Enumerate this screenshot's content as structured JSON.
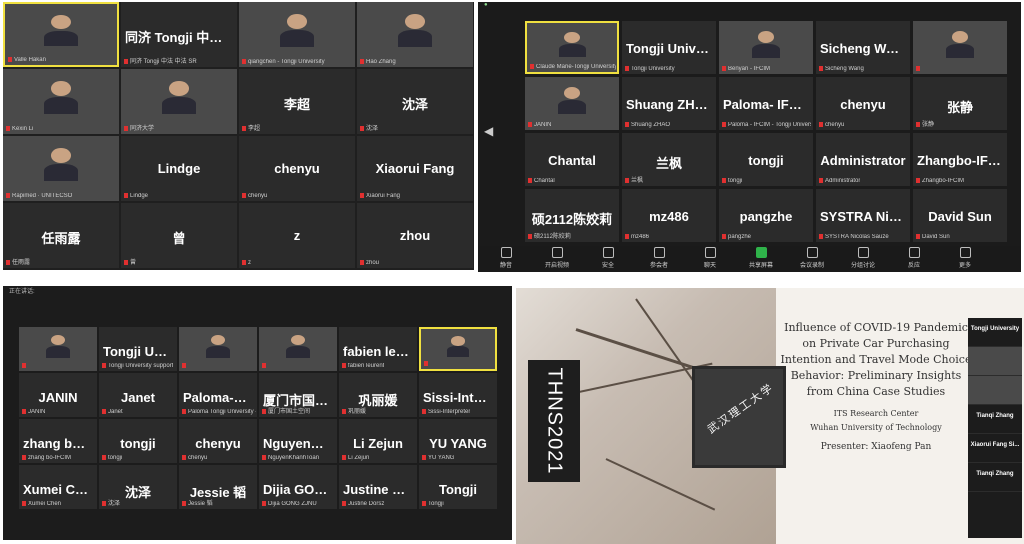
{
  "panel1": {
    "tiles": [
      {
        "big": "",
        "label": "Valle Hakan",
        "video": true
      },
      {
        "big": "同济 Tongji 中法...",
        "label": "同济 Tongji 中法 中法 SR",
        "video": false
      },
      {
        "big": "",
        "label": "qiangchen - Tongji University",
        "video": true
      },
      {
        "big": "",
        "label": "Hao Zhang",
        "video": true
      },
      {
        "big": "",
        "label": "Kexin Li",
        "video": true
      },
      {
        "big": "",
        "label": "同济大学",
        "video": true
      },
      {
        "big": "李超",
        "label": "李超",
        "video": false
      },
      {
        "big": "沈泽",
        "label": "沈泽",
        "video": false
      },
      {
        "big": "",
        "label": "Rapimed · UNITECSO",
        "video": true
      },
      {
        "big": "Lindge",
        "label": "Lindge",
        "video": false
      },
      {
        "big": "chenyu",
        "label": "chenyu",
        "video": false
      },
      {
        "big": "Xiaorui Fang",
        "label": "Xiaorui Fang",
        "video": false
      },
      {
        "big": "任雨露",
        "label": "任雨露",
        "video": false
      },
      {
        "big": "曾",
        "label": "曾",
        "video": false
      },
      {
        "big": "z",
        "label": "z",
        "video": false
      },
      {
        "big": "zhou",
        "label": "zhou",
        "video": false
      }
    ]
  },
  "panel2": {
    "tiles": [
      {
        "big": "",
        "label": "Claude Marie-Tongji University",
        "video": true
      },
      {
        "big": "Tongji University",
        "label": "Tongji University",
        "video": false
      },
      {
        "big": "",
        "label": "Benyan - IFCIM",
        "video": true
      },
      {
        "big": "Sicheng Wang",
        "label": "Sicheng Wang",
        "video": false
      },
      {
        "big": "",
        "label": "",
        "video": true
      },
      {
        "big": "",
        "label": "JANIN",
        "video": true
      },
      {
        "big": "Shuang ZHAO",
        "label": "Shuang ZHAO",
        "video": false
      },
      {
        "big": "Paloma- IFCIM-...",
        "label": "Paloma - IFCIM - Tongji University",
        "video": false
      },
      {
        "big": "chenyu",
        "label": "chenyu",
        "video": false
      },
      {
        "big": "张静",
        "label": "张静",
        "video": false
      },
      {
        "big": "Chantal",
        "label": "Chantal",
        "video": false
      },
      {
        "big": "兰枫",
        "label": "兰枫",
        "video": false
      },
      {
        "big": "tongji",
        "label": "tongji",
        "video": false
      },
      {
        "big": "Administrator",
        "label": "Administrator",
        "video": false
      },
      {
        "big": "Zhangbo-IFCIM",
        "label": "Zhangbo-IFCIM",
        "video": false
      },
      {
        "big": "硕2112陈姣莉",
        "label": "硕2112陈姣莉",
        "video": false
      },
      {
        "big": "mz486",
        "label": "mz486",
        "video": false
      },
      {
        "big": "pangzhe",
        "label": "pangzhe",
        "video": false
      },
      {
        "big": "SYSTRA Nicolas...",
        "label": "SYSTRA Nicolas Sauzé",
        "video": false
      },
      {
        "big": "David Sun",
        "label": "David Sun",
        "video": false
      }
    ],
    "toolbar": [
      "静音",
      "开启视频",
      "安全",
      "参会者",
      "聊天",
      "共享屏幕",
      "会议录制",
      "分组讨论",
      "反应",
      "更多"
    ]
  },
  "panel3": {
    "top": "正在讲话:",
    "tiles": [
      {
        "big": "",
        "label": "",
        "video": true
      },
      {
        "big": "Tongji Universit...",
        "label": "Tongji University support",
        "video": false
      },
      {
        "big": "",
        "label": "",
        "video": true
      },
      {
        "big": "",
        "label": "",
        "video": true
      },
      {
        "big": "fabien leurent",
        "label": "fabien leurent",
        "video": false
      },
      {
        "big": "",
        "label": "",
        "video": true
      },
      {
        "big": "JANIN",
        "label": "JANIN",
        "video": false
      },
      {
        "big": "Janet",
        "label": "Janet",
        "video": false
      },
      {
        "big": "Paloma-Tongji...",
        "label": "Paloma Tongji University - IFCIM",
        "video": false
      },
      {
        "big": "厦门市国土空间...",
        "label": "厦门市国土空间",
        "video": false
      },
      {
        "big": "巩丽媛",
        "label": "巩丽媛",
        "video": false
      },
      {
        "big": "Sissi-Interpreter",
        "label": "Sissi-Interpreter",
        "video": false
      },
      {
        "big": "zhang bo-IFCIM",
        "label": "zhang bo-IFCIM",
        "video": false
      },
      {
        "big": "tongji",
        "label": "tongji",
        "video": false
      },
      {
        "big": "chenyu",
        "label": "chenyu",
        "video": false
      },
      {
        "big": "NguyenKhanhT...",
        "label": "NguyenKhanhToan",
        "video": false
      },
      {
        "big": "Li Zejun",
        "label": "Li Zejun",
        "video": false
      },
      {
        "big": "YU YANG",
        "label": "YU YANG",
        "video": false
      },
      {
        "big": "Xumei Chen",
        "label": "Xumei Chen",
        "video": false
      },
      {
        "big": "沈泽",
        "label": "沈泽",
        "video": false
      },
      {
        "big": "Jessie 韬",
        "label": "Jessie 韬",
        "video": false
      },
      {
        "big": "Dijia GONG ZJNU",
        "label": "Dijia GONG ZJNU",
        "video": false
      },
      {
        "big": "Justine Dorsz",
        "label": "Justine Dorsz",
        "video": false
      },
      {
        "big": "Tongji",
        "label": "Tongji",
        "video": false
      }
    ]
  },
  "slide": {
    "banner": "THNS2021",
    "sign": "武汉理工大学",
    "title": "Influence of COVID-19 Pandemic on Private Car Purchasing Intention and Travel Mode Choice Behavior: Preliminary Insights from China Case Studies",
    "center": "ITS Research Center",
    "university": "Wuhan University of Technology",
    "presenter": "Presenter: Xiaofeng Pan",
    "side": [
      "Tongji University",
      "",
      "",
      "Tianqi Zhang",
      "Xiaorui Fang Si...",
      "Tianqi Zhang"
    ]
  }
}
